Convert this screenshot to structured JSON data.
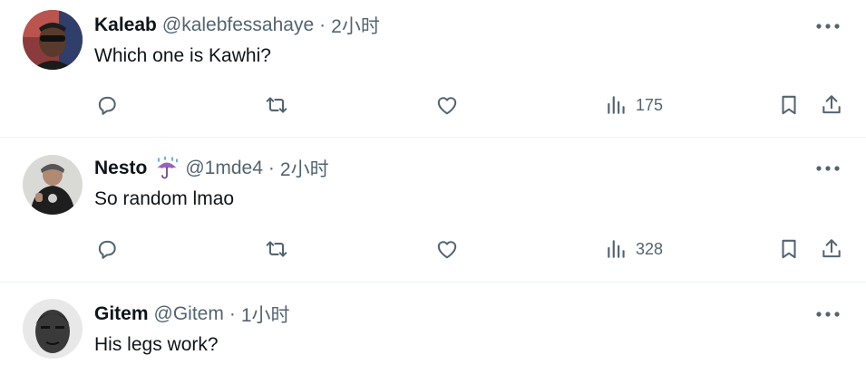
{
  "tweets": [
    {
      "name": "Kaleab",
      "handle": "@kalebfessahaye",
      "separator": "·",
      "time": "2小时",
      "text": "Which one is Kawhi?",
      "views": "175",
      "has_emoji": false
    },
    {
      "name": "Nesto",
      "emoji": "umbrella-rain-icon",
      "handle": "@1mde4",
      "separator": "·",
      "time": "2小时",
      "text": "So random lmao",
      "views": "328",
      "has_emoji": true
    },
    {
      "name": "Gitem",
      "handle": "@Gitem",
      "separator": "·",
      "time": "1小时",
      "text": "His legs work?",
      "has_emoji": false
    }
  ],
  "colors": {
    "text": "#0f1419",
    "secondary": "#536471",
    "divider": "#eff3f4",
    "emoji_purple": "#9b5fc0"
  },
  "icons": [
    "reply-icon",
    "retweet-icon",
    "like-icon",
    "views-icon",
    "bookmark-icon",
    "share-icon",
    "more-icon"
  ]
}
